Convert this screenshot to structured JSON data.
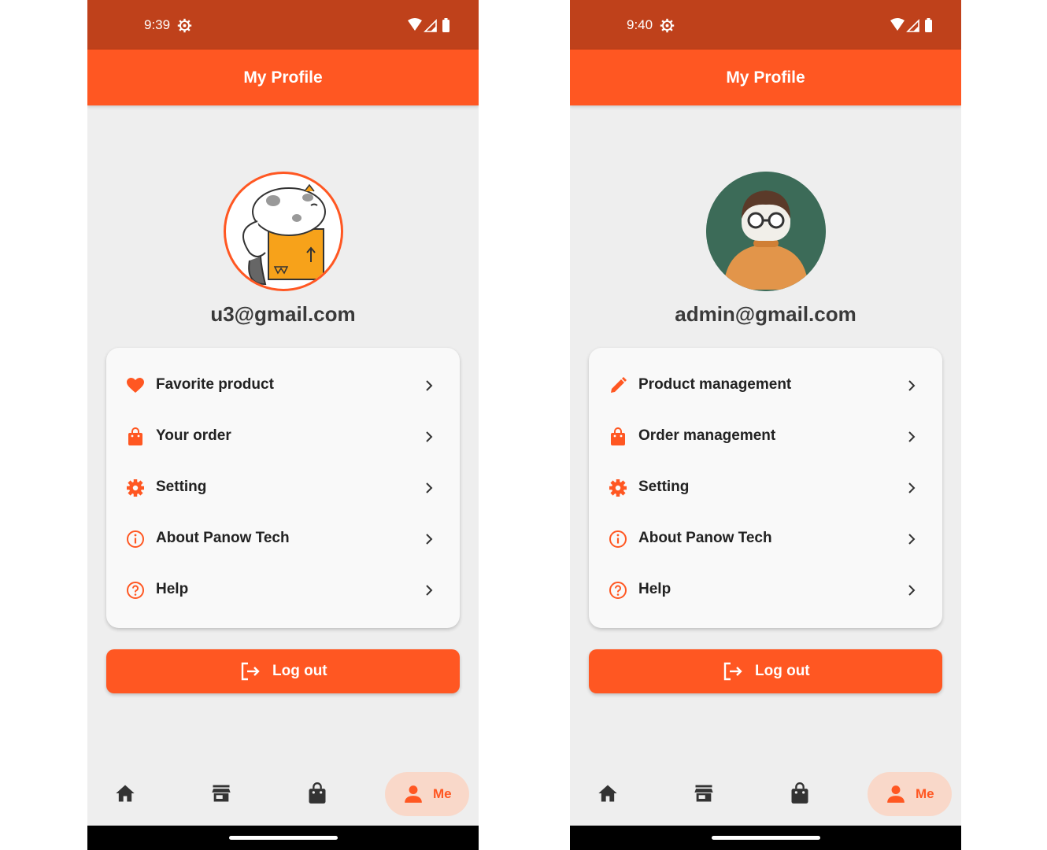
{
  "colors": {
    "primary": "#ff5722",
    "status_bar": "#bf411b",
    "background": "#eeeeee",
    "card": "#f9f9f9",
    "nav_active_bg": "#f9d8c9"
  },
  "screens": [
    {
      "status": {
        "time": "9:39"
      },
      "app_bar": {
        "title": "My Profile"
      },
      "profile": {
        "email": "u3@gmail.com",
        "avatar": "cat-in-box-avatar"
      },
      "menu": [
        {
          "label": "Favorite product",
          "icon": "heart-icon"
        },
        {
          "label": "Your order",
          "icon": "shopping-bag-icon"
        },
        {
          "label": "Setting",
          "icon": "gear-icon"
        },
        {
          "label": "About Panow Tech",
          "icon": "info-icon"
        },
        {
          "label": "Help",
          "icon": "help-icon"
        }
      ],
      "logout": {
        "label": "Log out"
      },
      "bottom_nav": {
        "active_label": "Me"
      }
    },
    {
      "status": {
        "time": "9:40"
      },
      "app_bar": {
        "title": "My Profile"
      },
      "profile": {
        "email": "admin@gmail.com",
        "avatar": "person-with-glasses-avatar"
      },
      "menu": [
        {
          "label": "Product management",
          "icon": "pencil-icon"
        },
        {
          "label": "Order management",
          "icon": "shopping-bag-icon"
        },
        {
          "label": "Setting",
          "icon": "gear-icon"
        },
        {
          "label": "About Panow Tech",
          "icon": "info-icon"
        },
        {
          "label": "Help",
          "icon": "help-icon"
        }
      ],
      "logout": {
        "label": "Log out"
      },
      "bottom_nav": {
        "active_label": "Me"
      }
    }
  ]
}
